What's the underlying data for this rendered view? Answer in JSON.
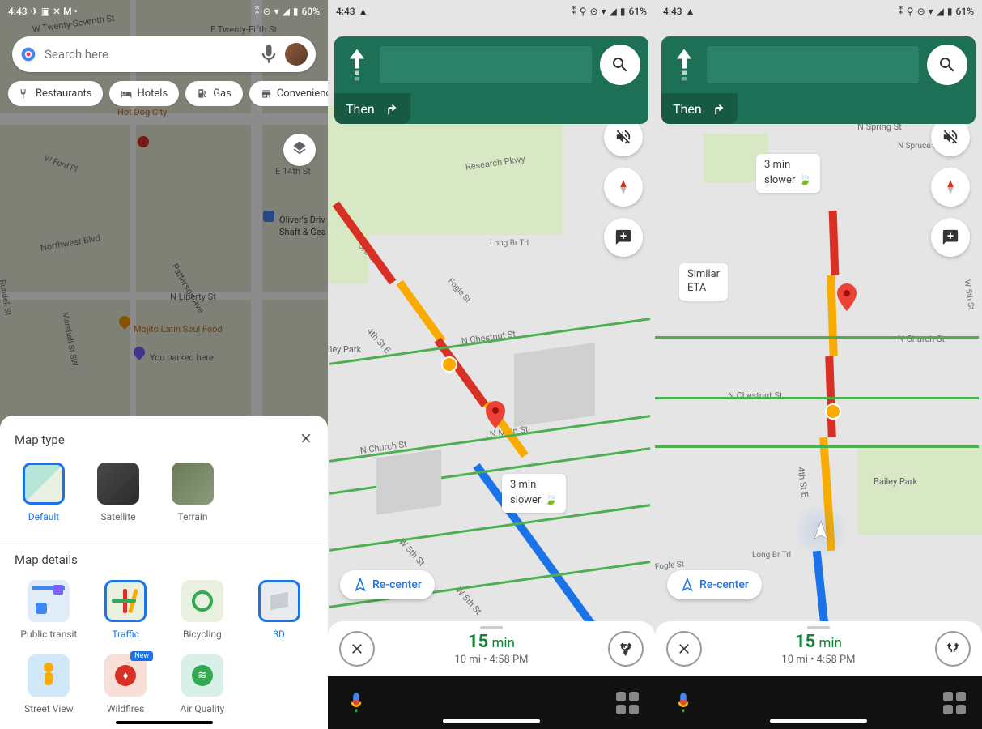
{
  "status1": {
    "time": "4:43",
    "battery": "60%"
  },
  "status2": {
    "time": "4:43",
    "battery": "61%"
  },
  "status3": {
    "time": "4:43",
    "battery": "61%"
  },
  "search": {
    "placeholder": "Search here"
  },
  "chips": [
    "Restaurants",
    "Hotels",
    "Gas",
    "Convenience"
  ],
  "sheet": {
    "title_type": "Map type",
    "title_details": "Map details",
    "types": [
      {
        "label": "Default",
        "selected": true
      },
      {
        "label": "Satellite",
        "selected": false
      },
      {
        "label": "Terrain",
        "selected": false
      }
    ],
    "details": [
      {
        "label": "Public transit",
        "selected": false,
        "cls": "dt-transit"
      },
      {
        "label": "Traffic",
        "selected": true,
        "cls": "dt-traffic"
      },
      {
        "label": "Bicycling",
        "selected": false,
        "cls": "dt-bike"
      },
      {
        "label": "3D",
        "selected": true,
        "cls": "dt-3d"
      },
      {
        "label": "Street View",
        "selected": false,
        "cls": "dt-street"
      },
      {
        "label": "Wildfires",
        "selected": false,
        "new": true,
        "cls": "dt-fire"
      },
      {
        "label": "Air Quality",
        "selected": false,
        "cls": "dt-air"
      }
    ]
  },
  "nav": {
    "then": "Then",
    "recenter": "Re-center",
    "eta_num": "15",
    "eta_unit": "min",
    "eta_sub": "10 mi  •  4:58 PM",
    "slower": "3 min\nslower",
    "similar": "Similar\nETA"
  },
  "streets": {
    "research": "Research Pkwy",
    "chestnut": "N Chestnut St",
    "church": "N Church St",
    "main": "N Main St",
    "fifth": "W 5th St",
    "fourth": "4th St E",
    "third": "3rd St E",
    "fogle": "Fogle St",
    "longbr": "Long Br Trl",
    "bailey": "Bailey Park",
    "spring": "N Spring St",
    "spruce": "N Spruce St",
    "liberty": "N Liberty St",
    "patterson": "Patterson Ave",
    "marshall": "Marshall St SW",
    "northwest": "Northwest Blvd",
    "twentyfifth": "E Twenty-Fifth St",
    "twentyseventh": "W Twenty-Seventh St",
    "fourteenth": "E 14th St",
    "olivers": "Oliver's Driv",
    "shaft": "Shaft & Gea",
    "mojito": "Mojito Latin Soul Food",
    "parked": "You parked here",
    "hotdog": "Hot Dog City",
    "rundell": "Rundell St",
    "wford": "W Ford Pl"
  }
}
